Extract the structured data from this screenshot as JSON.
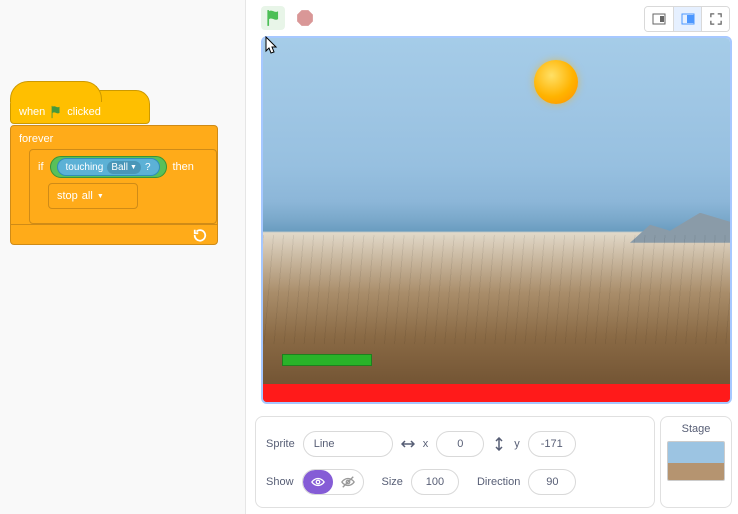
{
  "blocks": {
    "event_when": "when",
    "event_clicked": "clicked",
    "forever": "forever",
    "if": "if",
    "then": "then",
    "touching": "touching",
    "touching_arg": "Ball",
    "touching_q": "?",
    "stop": "stop",
    "stop_arg": "all"
  },
  "sprite_panel": {
    "sprite_label": "Sprite",
    "sprite_name": "Line",
    "x_label": "x",
    "x_value": "0",
    "y_label": "y",
    "y_value": "-171",
    "show_label": "Show",
    "size_label": "Size",
    "size_value": "100",
    "direction_label": "Direction",
    "direction_value": "90"
  },
  "stage_panel": {
    "label": "Stage"
  }
}
